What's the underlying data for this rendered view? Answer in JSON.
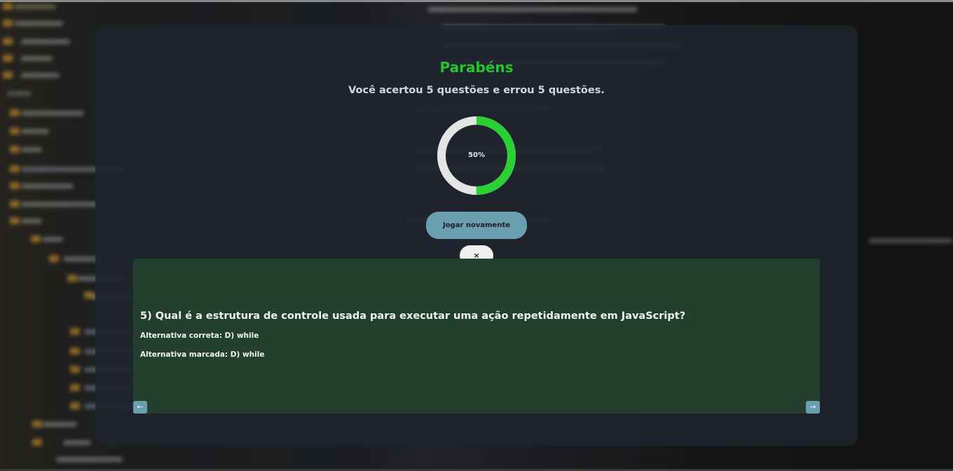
{
  "result": {
    "title": "Parabéns",
    "summary": "Você acertou 5 questões e errou 5 questões.",
    "score_percent": 50,
    "score_label": "50%",
    "play_again_label": "Jogar novamente",
    "close_label": "×"
  },
  "review": {
    "question": "5) Qual é a estrutura de controle usada para executar uma ação repetidamente em JavaScript?",
    "correct_answer": "Alternativa correta: D) while",
    "marked_answer": "Alternativa marcada: D) while",
    "prev_icon": "arrow-left-icon",
    "next_icon": "arrow-right-icon"
  },
  "colors": {
    "title": "#22c72a",
    "ring_progress": "#2bd034",
    "ring_track": "#e4e4e4",
    "play_button": "#6a9fb0",
    "review_panel": "#23402e"
  }
}
